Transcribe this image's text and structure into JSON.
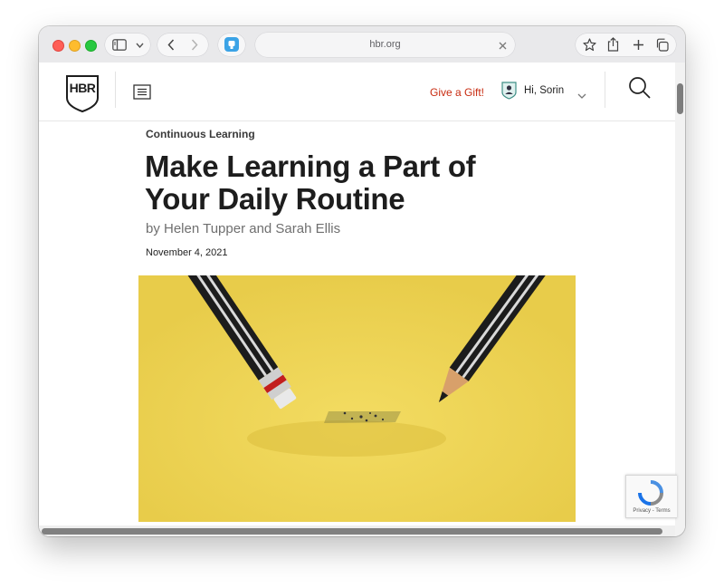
{
  "browser": {
    "address": "hbr.org"
  },
  "site": {
    "logo_text": "HBR",
    "gift_label": "Give a Gift!",
    "greeting": "Hi, Sorin",
    "accent_color": "#c82b10"
  },
  "article": {
    "category": "Continuous Learning",
    "headline": "Make Learning a Part of Your Daily Routine",
    "byline": "by Helen Tupper and Sarah Ellis",
    "date": "November 4, 2021",
    "hero_background": "#efd458"
  },
  "recaptcha": {
    "label": "Privacy - Terms"
  }
}
